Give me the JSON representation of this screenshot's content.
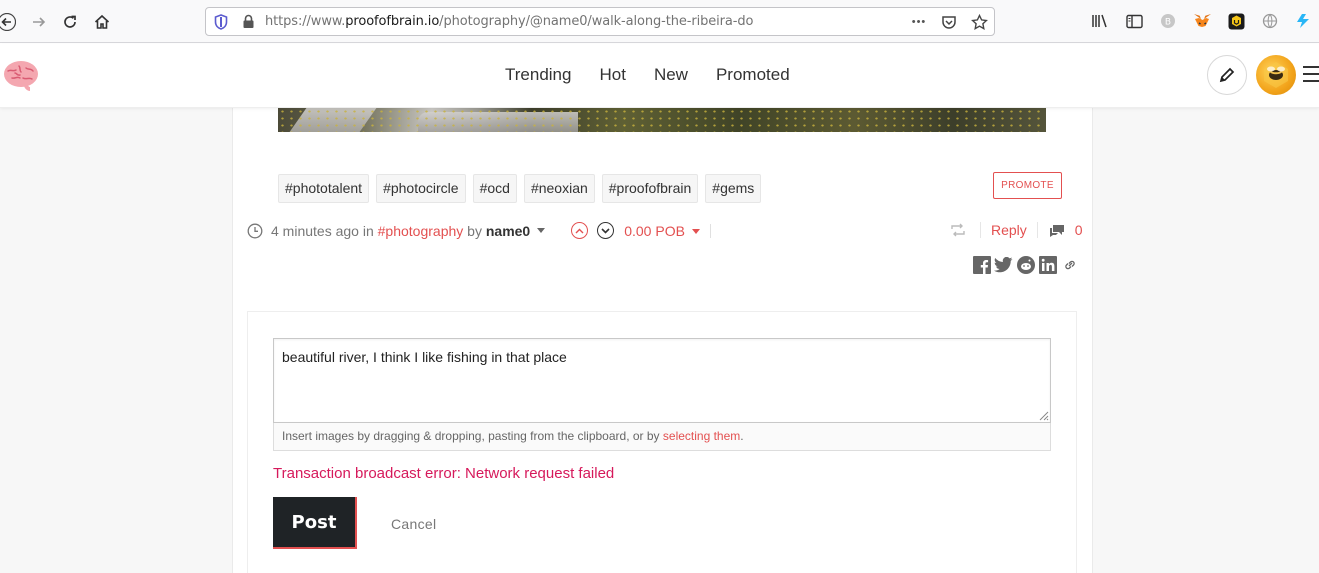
{
  "browser": {
    "url_prefix": "https://www.",
    "url_host": "proofofbrain.io",
    "url_path": "/photography/@name0/walk-along-the-ribeira-do",
    "more_glyph": "•••"
  },
  "nav": {
    "items": [
      "Trending",
      "Hot",
      "New",
      "Promoted"
    ]
  },
  "post": {
    "tags": [
      "#phototalent",
      "#photocircle",
      "#ocd",
      "#neoxian",
      "#proofofbrain",
      "#gems"
    ],
    "promote_label": "PROMOTE",
    "time_ago": "4 minutes ago",
    "in_label": "in",
    "category": "#photography",
    "by_label": "by",
    "author": "name0",
    "payout": "0.00 POB",
    "reply_label": "Reply",
    "comment_count": "0"
  },
  "reply_form": {
    "text": "beautiful river, I think I like fishing in that place",
    "upload_hint_prefix": "Insert images by dragging & dropping, pasting from the clipboard, or by ",
    "upload_hint_link": "selecting them",
    "upload_hint_suffix": ".",
    "error": "Transaction broadcast error: Network request failed",
    "post_label": "Post",
    "cancel_label": "Cancel"
  },
  "colors": {
    "accent": "#e35050",
    "error": "#d6195b",
    "button_dark": "#1f2326"
  }
}
